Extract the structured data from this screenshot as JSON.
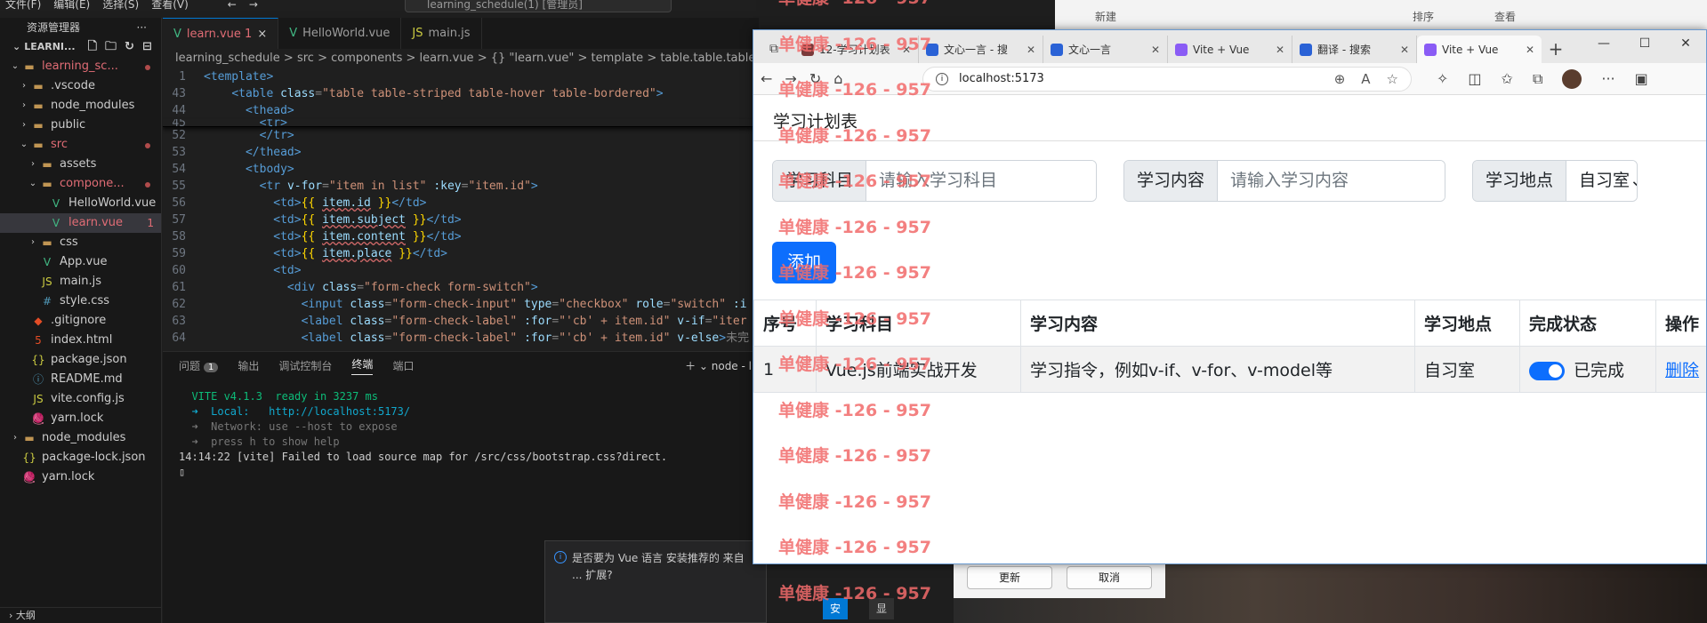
{
  "vscode": {
    "menu": [
      "文件(F)",
      "编辑(E)",
      "选择(S)",
      "查看(V)"
    ],
    "nav_back": "←",
    "nav_forward": "→",
    "search": "learning_schedule(1) [管理员]",
    "explorer_title": "资源管理器",
    "explorer_more": "···",
    "project_name": "LEARNI...",
    "tree": [
      {
        "label": "learning_sc...",
        "type": "folder-open",
        "depth": 1,
        "color": "#e06c75"
      },
      {
        "label": ".vscode",
        "type": "folder",
        "depth": 2
      },
      {
        "label": "node_modules",
        "type": "folder",
        "depth": 2
      },
      {
        "label": "public",
        "type": "folder",
        "depth": 2
      },
      {
        "label": "src",
        "type": "folder-open",
        "depth": 2,
        "color": "#e06c75"
      },
      {
        "label": "assets",
        "type": "folder",
        "depth": 3
      },
      {
        "label": "compone...",
        "type": "folder-open",
        "depth": 3,
        "color": "#e06c75"
      },
      {
        "label": "HelloWorld.vue",
        "type": "vue",
        "depth": 4
      },
      {
        "label": "learn.vue",
        "type": "vue",
        "depth": 4,
        "color": "#e06c75",
        "badge": "1",
        "selected": true
      },
      {
        "label": "css",
        "type": "folder",
        "depth": 3
      },
      {
        "label": "App.vue",
        "type": "vue",
        "depth": 3
      },
      {
        "label": "main.js",
        "type": "js",
        "depth": 3
      },
      {
        "label": "style.css",
        "type": "css",
        "depth": 3
      },
      {
        "label": ".gitignore",
        "type": "git",
        "depth": 2
      },
      {
        "label": "index.html",
        "type": "html",
        "depth": 2
      },
      {
        "label": "package.json",
        "type": "json",
        "depth": 2
      },
      {
        "label": "README.md",
        "type": "md",
        "depth": 2
      },
      {
        "label": "vite.config.js",
        "type": "js",
        "depth": 2
      },
      {
        "label": "yarn.lock",
        "type": "yarn",
        "depth": 2
      },
      {
        "label": "node_modules",
        "type": "folder",
        "depth": 1
      },
      {
        "label": "package-lock.json",
        "type": "json",
        "depth": 1
      },
      {
        "label": "yarn.lock",
        "type": "yarn",
        "depth": 1
      }
    ],
    "outline": "大纲",
    "tabs": [
      {
        "label": "learn.vue 1",
        "close": "×",
        "active": true
      },
      {
        "label": "HelloWorld.vue"
      },
      {
        "label": "main.js"
      }
    ],
    "breadcrumb": "learning_schedule  >  src  >  components  >  learn.vue  >  {} \"learn.vue\"  >  template  >  table.table.table-striped",
    "panel_tabs": [
      "问题",
      "输出",
      "调试控制台",
      "终端",
      "端口"
    ],
    "problems_count": "1",
    "panel_right": "＋ ⌄   node - l",
    "terminal": [
      "",
      "  VITE v4.1.3  ready in 3237 ms",
      "",
      "  ➜  Local:   http://localhost:5173/",
      "  ➜  Network: use --host to expose",
      "  ➜  press h to show help",
      "14:14:22 [vite] Failed to load source map for /src/css/bootstrap.css?direct.",
      "▯"
    ],
    "notification": {
      "info_icon": "i",
      "text": "是否要为 Vue 语言 安装推荐的 来自 ... 扩展?",
      "install": "安装",
      "show_recommendations": "显示建议"
    }
  },
  "background": {
    "update": "更新",
    "cancel": "取消",
    "new": "新建",
    "sort": "排序",
    "view": "查看"
  },
  "browser": {
    "tabs": [
      {
        "label": "12-学习计划表",
        "icon_color": "#7a3a3a"
      },
      {
        "label": "文心一言 - 搜",
        "icon_color": "#2a62d6"
      },
      {
        "label": "文心一言",
        "icon_color": "#2a62d6"
      },
      {
        "label": "Vite + Vue",
        "icon_color": "#8a5cf5"
      },
      {
        "label": "翻译 - 搜索",
        "icon_color": "#2a62d6"
      },
      {
        "label": "Vite + Vue",
        "icon_color": "#8a5cf5",
        "active": true
      }
    ],
    "new_tab": "+",
    "win_controls": [
      "—",
      "☐",
      "✕"
    ],
    "url": "localhost:5173",
    "page": {
      "title": "学习计划表",
      "subject_label": "学习科目",
      "subject_placeholder": "请输入学习科目",
      "content_label": "学习内容",
      "content_placeholder": "请输入学习内容",
      "place_label": "学习地点",
      "place_value": "自习室",
      "add_button": "添加",
      "table_headers": [
        "序号",
        "学习科目",
        "学习内容",
        "学习地点",
        "完成状态",
        "操作"
      ],
      "rows": [
        {
          "id": "1",
          "subject": "Vue.js前端实战开发",
          "content": "学习指令，例如v-if、v-for、v-model等",
          "place": "自习室",
          "status": "已完成",
          "action": "删除",
          "done": true
        }
      ]
    }
  },
  "watermark": "单健康 -126 - 957"
}
